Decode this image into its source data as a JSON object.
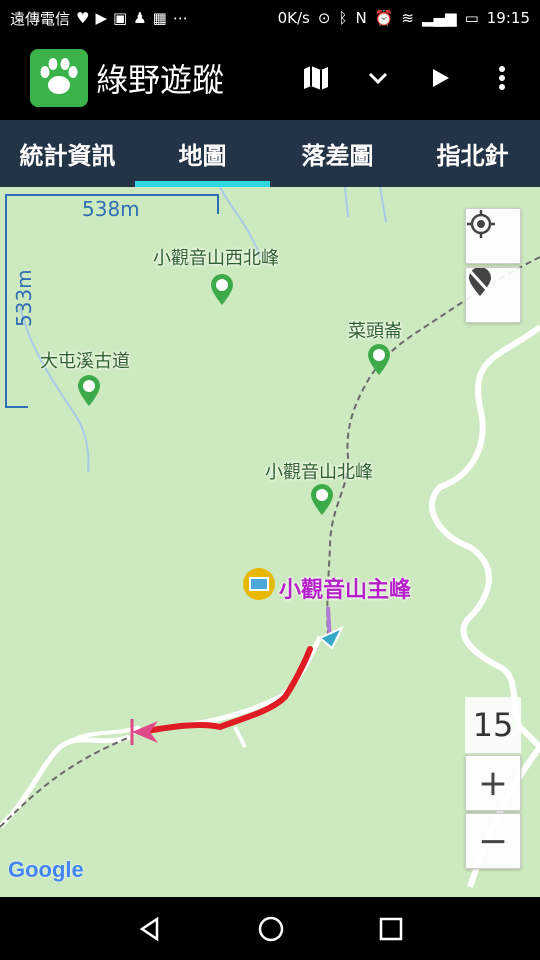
{
  "status_bar": {
    "carrier": "遠傳電信",
    "net_speed": "0K/s",
    "time": "19:15"
  },
  "app": {
    "title": "綠野遊蹤",
    "logo_icon": "paw-icon",
    "actions": [
      "map-icon",
      "chevron-down-icon",
      "play-icon",
      "more-vert-icon"
    ]
  },
  "tabs": [
    {
      "label": "統計資訊",
      "active": false
    },
    {
      "label": "地圖",
      "active": true
    },
    {
      "label": "落差圖",
      "active": false
    },
    {
      "label": "指北針",
      "active": false
    }
  ],
  "map": {
    "scale_horizontal": "538m",
    "scale_vertical": "533m",
    "zoom_level": "15",
    "zoom_in": "+",
    "zoom_out": "−",
    "attribution": "Google",
    "peak_name": "小觀音山主峰",
    "places": [
      {
        "name": "小觀音山西北峰"
      },
      {
        "name": "菜頭崙"
      },
      {
        "name": "大屯溪古道"
      },
      {
        "name": "小觀音山北峰"
      }
    ],
    "colors": {
      "land": "#cde9bf",
      "track": "#e01b24",
      "peak_label": "#b521c9",
      "scale": "#2e6fb5"
    }
  }
}
